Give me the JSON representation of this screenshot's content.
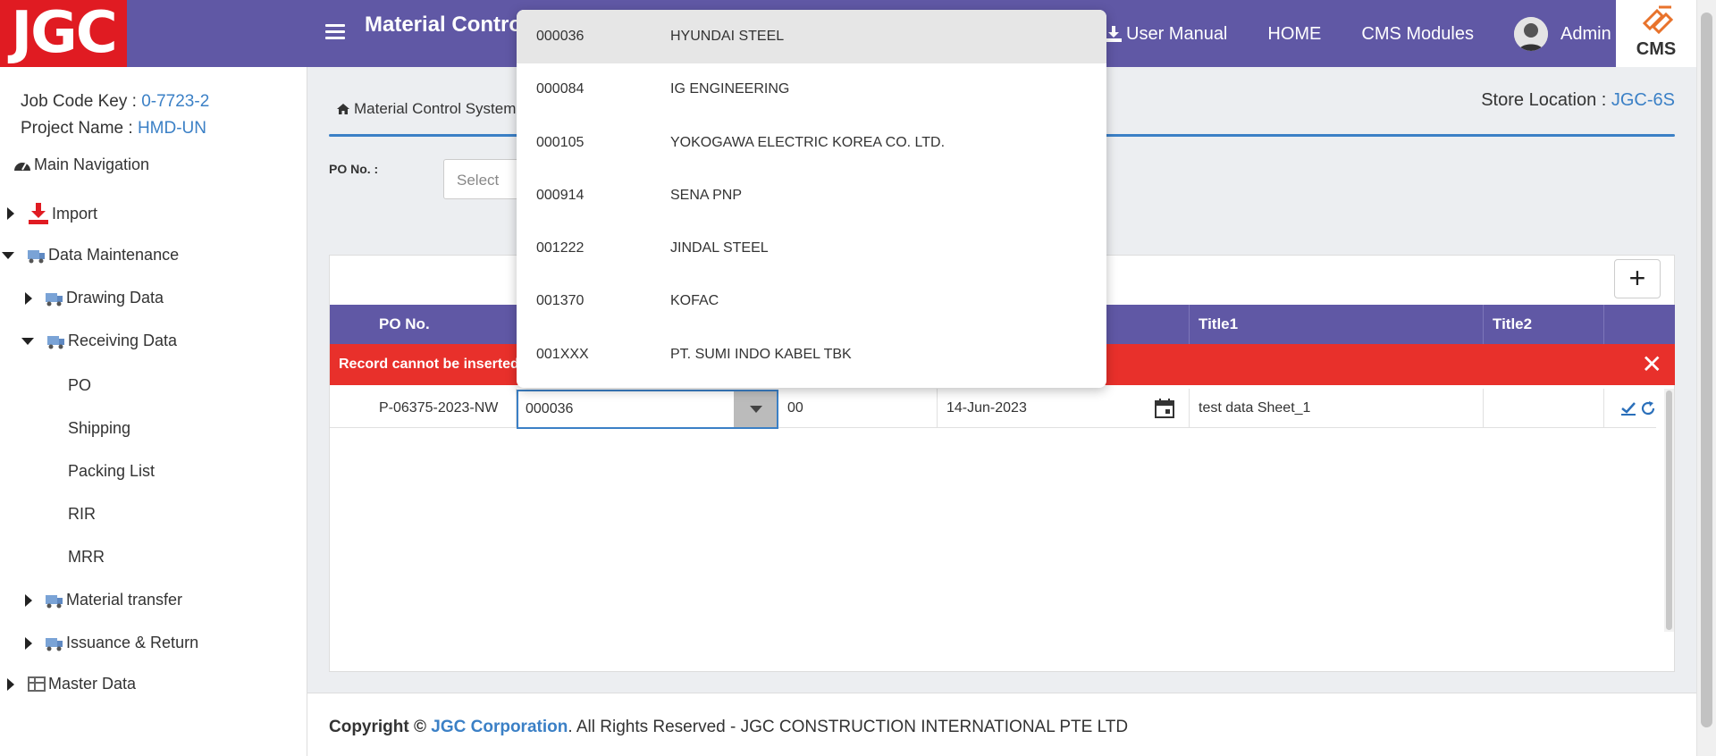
{
  "header": {
    "logo": "JGC",
    "app_title": "Material Control System",
    "user_manual": "User Manual",
    "home": "HOME",
    "cms_modules": "CMS Modules",
    "user": "Admin",
    "cms_logo_text": "CMS",
    "bg_color": "#6058a5",
    "logo_color": "#e01b22"
  },
  "sidebar": {
    "job_code_label": "Job Code Key : ",
    "job_code": "0-7723-2",
    "project_label": "Project Name : ",
    "project": "HMD-UN",
    "main_nav": "Main Navigation",
    "items": {
      "import": "Import",
      "data_maintenance": "Data Maintenance",
      "drawing_data": "Drawing Data",
      "receiving_data": "Receiving Data",
      "po": "PO",
      "shipping": "Shipping",
      "packing_list": "Packing List",
      "rir": "RIR",
      "mrr": "MRR",
      "material_transfer": "Material transfer",
      "issuance_return": "Issuance & Return",
      "master_data": "Master Data"
    }
  },
  "main": {
    "breadcrumb": "Material Control System",
    "store_label": "Store Location : ",
    "store_value": "JGC-6S",
    "po_label": "PO No. :",
    "po_placeholder": "Select",
    "columns": {
      "po_no": "PO No.",
      "title1": "Title1",
      "title2": "Title2"
    },
    "error_text": "Record cannot be inserted",
    "row": {
      "po_no": "P-06375-2023-NW",
      "vendor_code": "000036",
      "revision": "00",
      "date": "14-Jun-2023",
      "title1": "test data Sheet_1",
      "title2": ""
    }
  },
  "dropdown": {
    "options": [
      {
        "code": "000036",
        "name": "HYUNDAI STEEL"
      },
      {
        "code": "000084",
        "name": "IG ENGINEERING"
      },
      {
        "code": "000105",
        "name": "YOKOGAWA ELECTRIC KOREA CO. LTD."
      },
      {
        "code": "000914",
        "name": "SENA PNP"
      },
      {
        "code": "001222",
        "name": "JINDAL STEEL"
      },
      {
        "code": "001370",
        "name": "KOFAC"
      },
      {
        "code": "001XXX",
        "name": "PT. SUMI INDO KABEL TBK"
      }
    ]
  },
  "footer": {
    "copyright": "Copyright © ",
    "company": "JGC Corporation",
    "rest": ". All Rights Reserved - JGC CONSTRUCTION INTERNATIONAL PTE LTD"
  }
}
